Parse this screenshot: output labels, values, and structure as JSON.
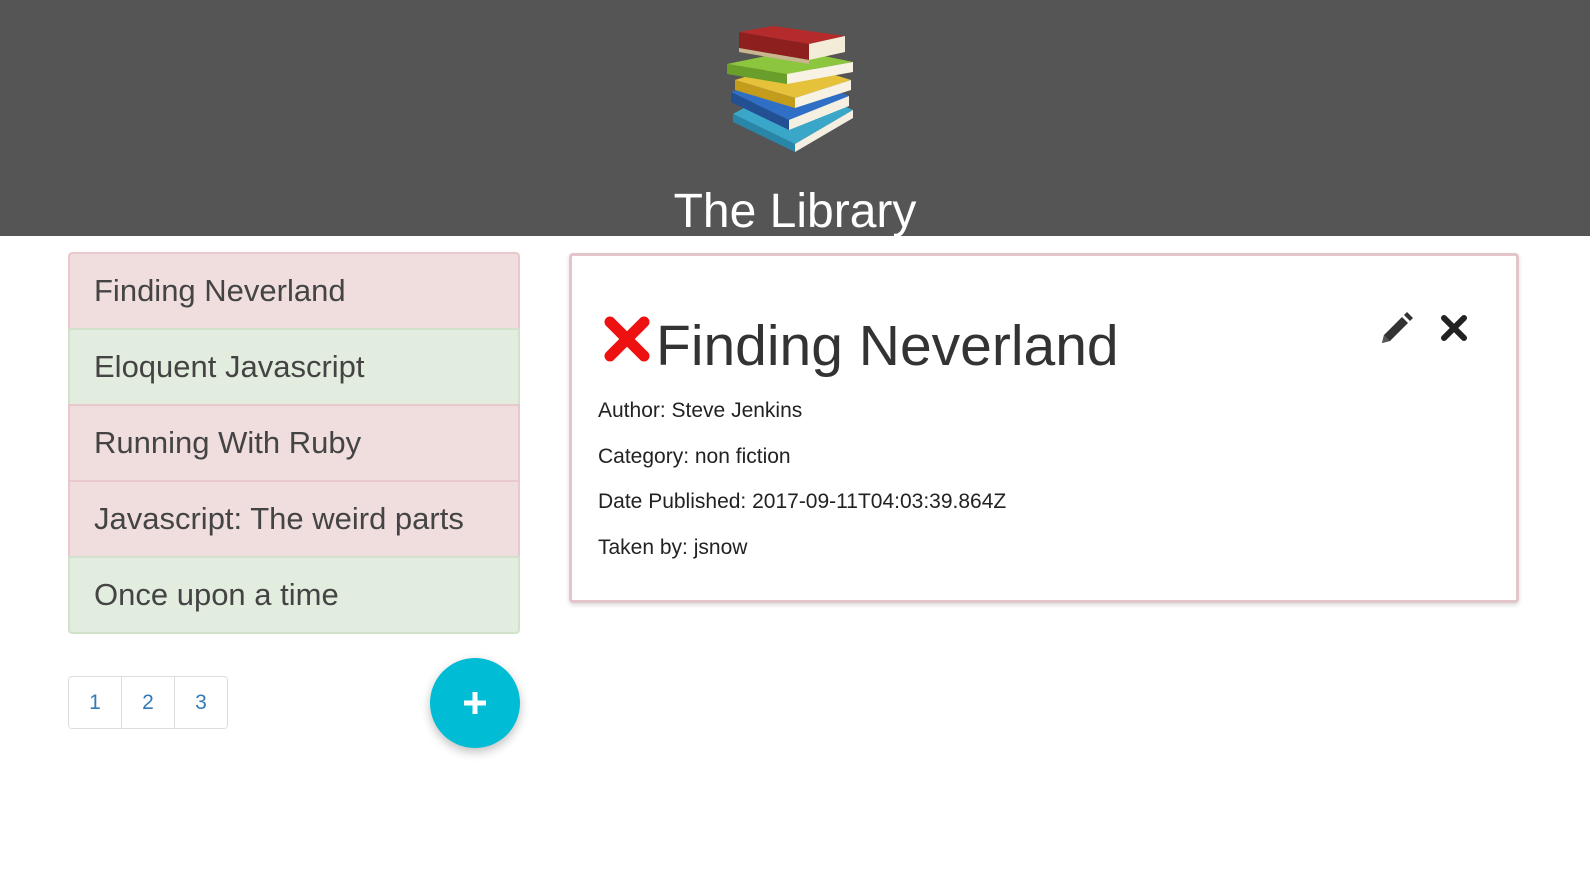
{
  "header": {
    "title": "The Library",
    "logo_icon": "book-stack-icon"
  },
  "book_list": {
    "items": [
      {
        "label": "Finding Neverland",
        "status": "taken"
      },
      {
        "label": "Eloquent Javascript",
        "status": "available"
      },
      {
        "label": "Running With Ruby",
        "status": "taken"
      },
      {
        "label": "Javascript: The weird parts",
        "status": "taken"
      },
      {
        "label": "Once upon a time",
        "status": "available"
      }
    ]
  },
  "pagination": {
    "pages": [
      "1",
      "2",
      "3"
    ]
  },
  "add_button": {
    "icon": "plus-icon"
  },
  "detail": {
    "status_icon": "red-x-icon",
    "title": "Finding Neverland",
    "author": "Author: Steve Jenkins",
    "category": "Category: non fiction",
    "date_published": "Date Published: 2017-09-11T04:03:39.864Z",
    "taken_by": "Taken by: jsnow",
    "edit_icon": "pencil-icon",
    "delete_icon": "close-icon"
  },
  "colors": {
    "header_bg": "#555555",
    "taken_bg": "#f0dedf",
    "available_bg": "#e3eddf",
    "fab": "#00bcd4",
    "status_red": "#ee1111",
    "link_blue": "#337ab7"
  }
}
